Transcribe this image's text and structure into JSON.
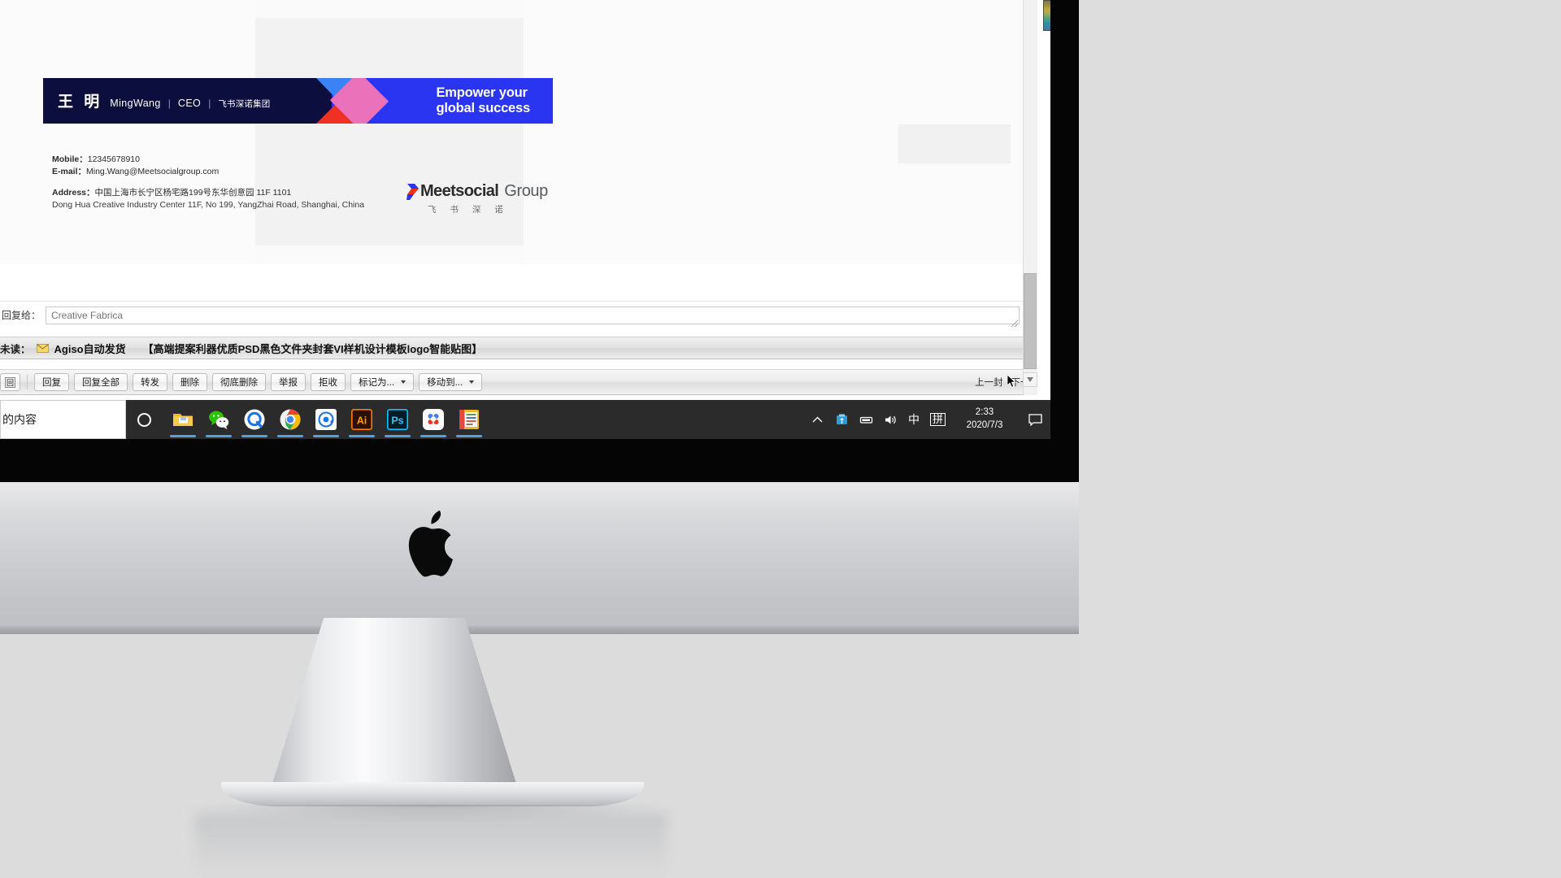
{
  "signature": {
    "banner": {
      "cn_name": "王 明",
      "en_name": "MingWang",
      "separator": "|",
      "role": "CEO",
      "company_cn": "飞书深诺集团",
      "tagline_line1": "Empower your",
      "tagline_line2": "global success",
      "colors": {
        "navy": "#0c0f3d",
        "blue": "#2a35f2",
        "light_blue": "#3b82f6",
        "pink": "#ec71bb",
        "red": "#ef3124"
      }
    },
    "contacts": {
      "mobile_label": "Mobile：",
      "mobile_value": "12345678910",
      "email_label": "E-mail：",
      "email_value": "Ming.Wang@Meetsocialgroup.com",
      "address_label": "Address：",
      "address_cn": "中国上海市长宁区杨宅路199号东华创意园 11F 1101",
      "address_en": "Dong Hua Creative Industry Center 11F, No 199, YangZhai Road, Shanghai, China"
    },
    "logo": {
      "word_primary": "Meetsocial",
      "word_secondary": "Group",
      "cn_subtitle": "飞 书 深 诺"
    }
  },
  "reply_bar": {
    "label": "回复给：",
    "value": "Creative Fabrica",
    "placeholder": "Creative Fabrica"
  },
  "subject_row": {
    "unread_label": "未读：",
    "envelope_icon": "envelope-icon",
    "sender": "Agiso自动发货",
    "subject": "【高端提案利器优质PSD黑色文件夹封套VI样机设计模板logo智能贴图】"
  },
  "toolbar": {
    "buttons": [
      {
        "name": "back-button",
        "label": "回",
        "icon": "back-icon",
        "has_caret": false
      },
      {
        "name": "reply-button",
        "label": "回复",
        "has_caret": false
      },
      {
        "name": "reply-all-button",
        "label": "回复全部",
        "has_caret": false
      },
      {
        "name": "forward-button",
        "label": "转发",
        "has_caret": false
      },
      {
        "name": "delete-button",
        "label": "删除",
        "has_caret": false
      },
      {
        "name": "permanent-delete-button",
        "label": "彻底删除",
        "has_caret": false
      },
      {
        "name": "report-button",
        "label": "举报",
        "has_caret": false
      },
      {
        "name": "reject-button",
        "label": "拒收",
        "has_caret": false
      },
      {
        "name": "mark-as-dropdown",
        "label": "标记为...",
        "has_caret": true
      },
      {
        "name": "move-to-dropdown",
        "label": "移动到...",
        "has_caret": true
      }
    ],
    "prev_link": "上一封",
    "next_link": "下一封"
  },
  "content_strip": {
    "text": "的内容"
  },
  "taskbar": {
    "cortana_icon": "cortana-circle-icon",
    "apps": [
      {
        "name": "file-explorer-icon",
        "label": "文件资源管理器"
      },
      {
        "name": "wechat-icon",
        "label": "WeChat"
      },
      {
        "name": "qq-browser-icon",
        "label": "QQ Browser"
      },
      {
        "name": "chrome-icon",
        "label": "Google Chrome"
      },
      {
        "name": "at-app-icon",
        "label": "@"
      },
      {
        "name": "illustrator-icon",
        "label": "Ai"
      },
      {
        "name": "photoshop-icon",
        "label": "Ps"
      },
      {
        "name": "baidu-netdisk-icon",
        "label": "Baidu Netdisk"
      },
      {
        "name": "notes-app-icon",
        "label": "Notes"
      }
    ],
    "tray": {
      "chevron_icon": "chevron-up-icon",
      "usb_icon": "usb-device-icon",
      "keyboard_icon": "keyboard-icon",
      "volume_icon": "volume-icon",
      "ime_label": "中",
      "pinyin_label": "拼",
      "time": "2:33",
      "date": "2020/7/3",
      "notification_icon": "notification-icon"
    }
  },
  "hardware": {
    "brand_logo": "apple-logo",
    "device": "iMac"
  }
}
